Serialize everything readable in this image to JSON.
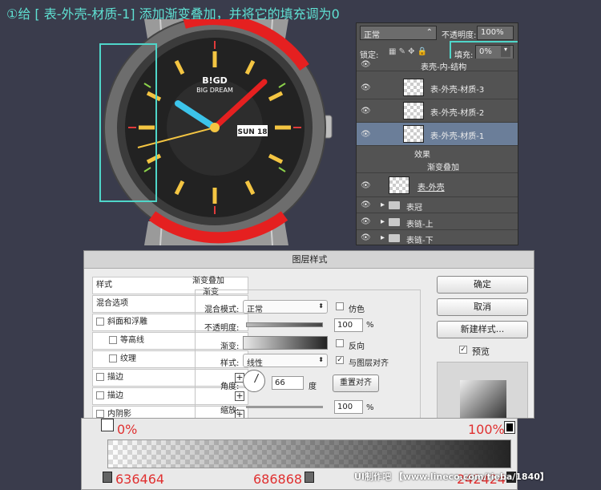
{
  "instruction": "①给 [ 表-外壳-材质-1] 添加渐变叠加，并将它的填充调为0",
  "watch": {
    "brand": "B!GD",
    "brand_sub": "BIG DREAM",
    "date": "SUN 18"
  },
  "layers_panel": {
    "blend_mode": "正常",
    "opacity_label": "不透明度:",
    "opacity_value": "100%",
    "lock_label": "锁定:",
    "fill_label": "填充:",
    "fill_value": "0%",
    "layers": [
      {
        "name": "表壳-内-结构"
      },
      {
        "name": "表-外壳-材质-3"
      },
      {
        "name": "表-外壳-材质-2"
      },
      {
        "name": "表-外壳-材质-1"
      },
      {
        "name": "效果"
      },
      {
        "name": "渐变叠加"
      },
      {
        "name": "表-外壳"
      },
      {
        "name": "表冠"
      },
      {
        "name": "表链-上"
      },
      {
        "name": "表链-下"
      }
    ]
  },
  "dialog": {
    "title": "图层样式",
    "left_items": [
      "样式",
      "混合选项",
      "斜面和浮雕",
      "等高线",
      "纹理",
      "描边",
      "描边",
      "内阴影"
    ],
    "section": "渐变叠加",
    "subsection": "渐变",
    "blend_label": "混合模式:",
    "blend_value": "正常",
    "dither_label": "仿色",
    "opacity_label": "不透明度:",
    "opacity_value": "100",
    "gradient_label": "渐变:",
    "reverse_label": "反向",
    "style_label": "样式:",
    "style_value": "线性",
    "align_label": "与图层对齐",
    "angle_label": "角度:",
    "angle_value": "66",
    "degree_unit": "度",
    "reset_button": "重置对齐",
    "scale_label": "缩放:",
    "scale_value": "100",
    "percent": "%",
    "ok_button": "确定",
    "cancel_button": "取消",
    "new_style_button": "新建样式...",
    "preview_label": "预览"
  },
  "gradient_editor": {
    "left_opacity": "0%",
    "right_opacity": "100%",
    "left_color": "636464",
    "mid_color": "686868",
    "right_color": "242424",
    "watermark": "UI制作吧  【www.lineco.com/tieba/1840】"
  }
}
